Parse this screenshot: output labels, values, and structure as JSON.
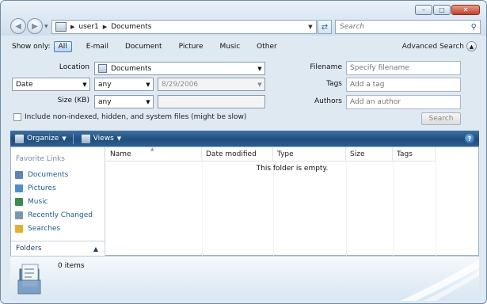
{
  "window": {
    "caption_buttons": [
      "minimize",
      "maximize",
      "close"
    ]
  },
  "address": {
    "crumbs": [
      "user1",
      "Documents"
    ]
  },
  "search": {
    "placeholder": "Search"
  },
  "filter": {
    "label": "Show only:",
    "chips": [
      "All",
      "E-mail",
      "Document",
      "Picture",
      "Music",
      "Other"
    ],
    "active": "All",
    "advanced_label": "Advanced Search"
  },
  "advanced": {
    "location_label": "Location",
    "location_value": "Documents",
    "date_field": "Date",
    "date_op": "any",
    "date_value": "8/29/2006",
    "size_label": "Size (KB)",
    "size_op": "any",
    "size_value": "",
    "include_label": "Include non-indexed, hidden, and system files (might be slow)",
    "filename_label": "Filename",
    "filename_placeholder": "Specify filename",
    "tags_label": "Tags",
    "tags_placeholder": "Add a tag",
    "authors_label": "Authors",
    "authors_placeholder": "Add an author",
    "search_button": "Search"
  },
  "commandbar": {
    "organize": "Organize",
    "views": "Views",
    "help": "?"
  },
  "navpane": {
    "title": "Favorite Links",
    "items": [
      {
        "label": "Documents",
        "color": "#5c86b0"
      },
      {
        "label": "Pictures",
        "color": "#4f8fc9"
      },
      {
        "label": "Music",
        "color": "#3b8a4f"
      },
      {
        "label": "Recently Changed",
        "color": "#7c96b2"
      },
      {
        "label": "Searches",
        "color": "#e0b12f"
      }
    ],
    "folders_label": "Folders"
  },
  "filelist": {
    "columns": [
      "Name",
      "Date modified",
      "Type",
      "Size",
      "Tags"
    ],
    "empty_message": "This folder is empty."
  },
  "details": {
    "count": "0 items"
  }
}
